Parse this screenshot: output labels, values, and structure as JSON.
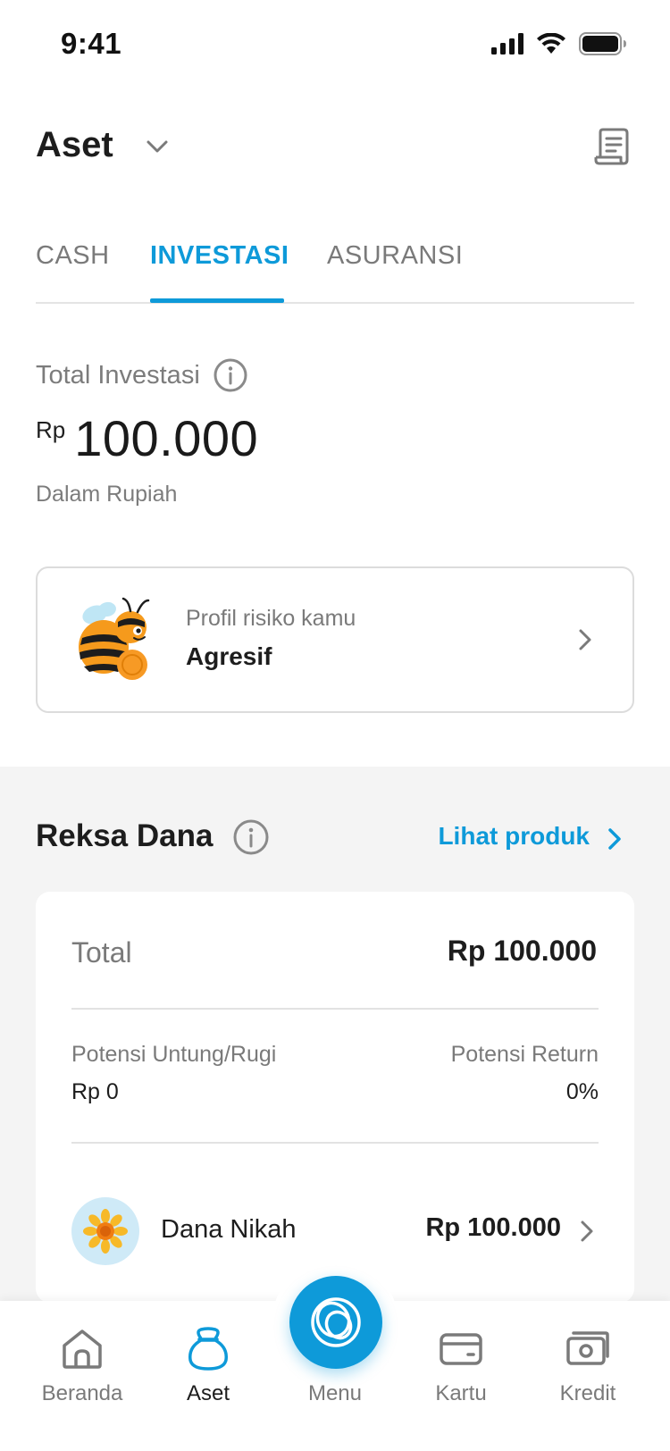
{
  "status_bar": {
    "time": "9:41"
  },
  "header": {
    "title": "Aset"
  },
  "tabs": [
    {
      "label": "CASH",
      "active": false
    },
    {
      "label": "INVESTASI",
      "active": true
    },
    {
      "label": "ASURANSI",
      "active": false
    }
  ],
  "summary": {
    "label": "Total Investasi",
    "currency": "Rp",
    "amount": "100.000",
    "subtitle": "Dalam Rupiah"
  },
  "risk_profile": {
    "label": "Profil risiko kamu",
    "value": "Agresif"
  },
  "reksa_dana": {
    "title": "Reksa Dana",
    "link_label": "Lihat produk",
    "total_label": "Total",
    "total_value": "Rp 100.000",
    "pl_label": "Potensi Untung/Rugi",
    "pl_value": "Rp 0",
    "return_label": "Potensi Return",
    "return_value": "0%",
    "funds": [
      {
        "name": "Dana Nikah",
        "value": "Rp 100.000",
        "icon": "sunflower-icon"
      }
    ]
  },
  "bottom_nav": {
    "items": [
      {
        "label": "Beranda",
        "icon": "home-icon",
        "active": false
      },
      {
        "label": "Aset",
        "icon": "moneybag-icon",
        "active": true
      },
      {
        "label": "Menu",
        "icon": "menu-rings-icon",
        "active": false
      },
      {
        "label": "Kartu",
        "icon": "card-icon",
        "active": false
      },
      {
        "label": "Kredit",
        "icon": "cash-icon",
        "active": false
      }
    ]
  },
  "colors": {
    "accent": "#0e9ad9",
    "text_primary": "#1d1d1d",
    "text_secondary": "#7a7a7a",
    "section_bg": "#f4f4f4"
  }
}
